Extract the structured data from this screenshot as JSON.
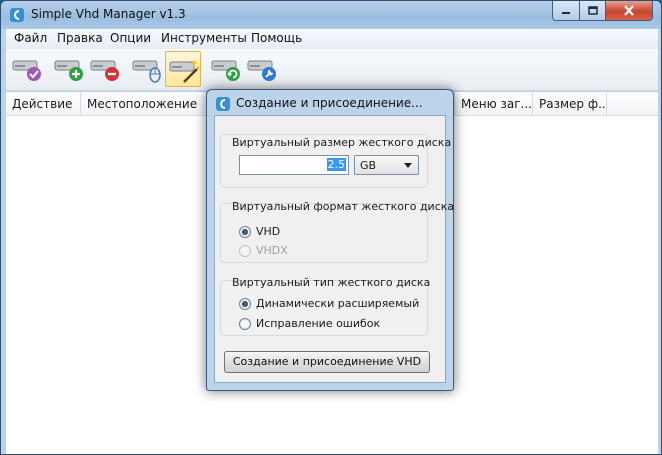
{
  "window": {
    "title": "Simple Vhd Manager v1.3",
    "controls": [
      "minimize-icon",
      "maximize-icon",
      "close-icon"
    ]
  },
  "menu": {
    "items": [
      "Файл",
      "Правка",
      "Опции",
      "Инструменты",
      "Помощь"
    ]
  },
  "toolbar": {
    "buttons": [
      {
        "icon": "disk-check-icon"
      },
      {
        "icon": "disk-add-icon"
      },
      {
        "icon": "disk-remove-icon"
      },
      {
        "icon": "disk-mouse-icon"
      },
      {
        "icon": "disk-wizard-icon",
        "active": true
      },
      {
        "icon": "disk-refresh-icon"
      },
      {
        "icon": "disk-settings-icon"
      }
    ]
  },
  "table": {
    "columns": [
      "Действие",
      "Местоположение",
      "Меню заг...",
      "Размер ф..."
    ]
  },
  "dialog": {
    "title": "Создание и присоединение...",
    "size_group": {
      "label": "Виртуальный размер жесткого диска",
      "value": "2.5",
      "unit": "GB"
    },
    "format_group": {
      "label": "Виртуальный формат жесткого диска",
      "options": [
        {
          "label": "VHD",
          "checked": true,
          "disabled": false
        },
        {
          "label": "VHDX",
          "checked": false,
          "disabled": true
        }
      ]
    },
    "type_group": {
      "label": "Виртуальный тип жесткого диска",
      "options": [
        {
          "label": "Динамически расширяемый",
          "checked": true
        },
        {
          "label": "Исправление ошибок",
          "checked": false
        }
      ]
    },
    "create_button": "Создание и присоединение VHD"
  },
  "colors": {
    "titlebar": "#9cbde0",
    "close_button": "#c9452c",
    "selection": "#3399ff",
    "active_tool": "#ffe79a"
  }
}
